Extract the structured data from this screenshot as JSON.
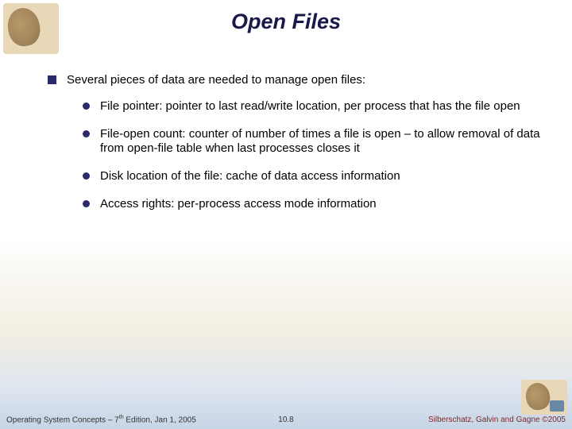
{
  "title": "Open Files",
  "main_point": "Several pieces of data are needed to manage open files:",
  "subpoints": [
    "File pointer:  pointer to last read/write location, per process that has the file open",
    "File-open count: counter of number of times a file is open – to allow removal of data from open-file table when last processes closes it",
    "Disk location of the file: cache of data access information",
    "Access rights: per-process access mode information"
  ],
  "footer": {
    "left_prefix": "Operating System Concepts – 7",
    "left_sup": "th",
    "left_suffix": " Edition, Jan 1, 2005",
    "center": "10.8",
    "right": "Silberschatz, Galvin and Gagne ©2005"
  }
}
